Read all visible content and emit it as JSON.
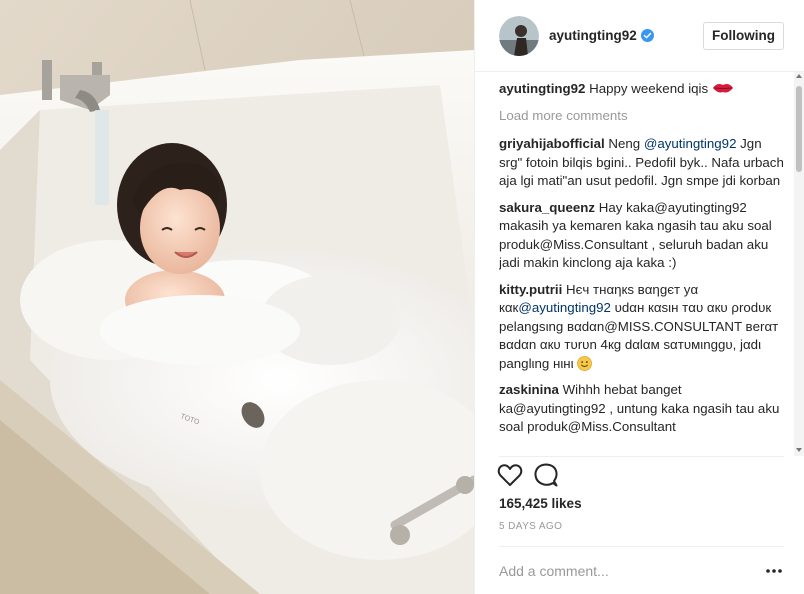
{
  "post": {
    "image_alt": "child in bubble bath",
    "author": {
      "username": "ayutingting92",
      "verified": true,
      "follow_label": "Following"
    },
    "caption": {
      "username": "ayutingting92",
      "text": "Happy weekend iqis",
      "emoji": "kiss-lips-icon"
    },
    "load_more_label": "Load more comments",
    "comments": [
      {
        "username": "griyahijabofficial",
        "pre": "Neng ",
        "mention": "@ayutingting92",
        "post": " Jgn srg\" fotoin bilqis bgini.. Pedofil byk.. Nafa urbach aja lgi mati\"an usut pedofil. Jgn smpe jdi korban"
      },
      {
        "username": "sakura_queenz",
        "text": "Hay kaka@ayutingting92 makasih ya kemaren kaka ngasih tau aku soal produk@Miss.Consultant , seluruh badan aku jadi makin kinclong aja kaka :)"
      },
      {
        "username": "kitty.putrii",
        "pre": "Нєч тнαηкѕ вαηgєт yα кαк",
        "mention": "@ayutingting92",
        "post": " υdαн кαѕιн тαυ αкυ ρrodυк pelangsιng вαdαn@MISS.CONSULTANT вerαт вαdαn αкυ тυrυn 4кg dαlαм ѕαтυмιnggυ, jαdι panglιng нιнι",
        "emoji": "smile-emoji-icon"
      },
      {
        "username": "zaskinina",
        "text": "Wihhh hebat banget ka@ayutingting92 , untung kaka ngasih tau aku soal produk@Miss.Consultant"
      }
    ],
    "likes_label": "165,425 likes",
    "timestamp": "5 DAYS AGO",
    "comment_placeholder": "Add a comment...",
    "colors": {
      "mention": "#003569",
      "muted": "#999999",
      "verified": "#3897f0",
      "border": "#efefef"
    }
  }
}
